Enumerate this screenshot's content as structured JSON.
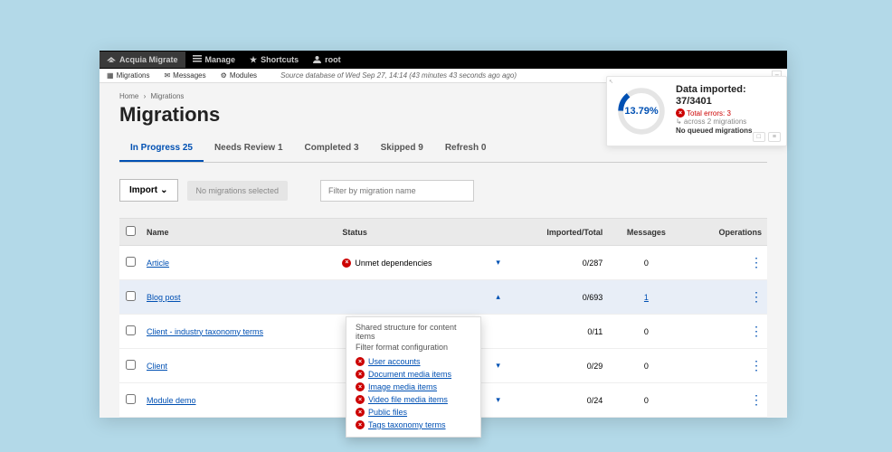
{
  "topbar": {
    "brand": "Acquia Migrate",
    "manage": "Manage",
    "shortcuts": "Shortcuts",
    "user": "root"
  },
  "secondbar": {
    "migrations": "Migrations",
    "messages": "Messages",
    "modules": "Modules",
    "source": "Source database of Wed Sep 27, 14:14 (43 minutes 43 seconds ago ago)"
  },
  "breadcrumb": {
    "home": "Home",
    "current": "Migrations"
  },
  "page_title": "Migrations",
  "tabs": [
    {
      "label": "In Progress",
      "count": "25",
      "active": true
    },
    {
      "label": "Needs Review",
      "count": "1",
      "active": false
    },
    {
      "label": "Completed",
      "count": "3",
      "active": false
    },
    {
      "label": "Skipped",
      "count": "9",
      "active": false
    },
    {
      "label": "Refresh",
      "count": "0",
      "active": false
    }
  ],
  "stats": {
    "tiny": "↖",
    "pct": "13.79%",
    "title": "Data imported:",
    "count": "37/3401",
    "errors": "Total errors: 3",
    "across": "↳ across 2 migrations",
    "noqueue": "No queued migrations"
  },
  "toolbar": {
    "import": "Import",
    "none_selected": "No migrations selected",
    "filter_placeholder": "Filter by migration name"
  },
  "columns": {
    "name": "Name",
    "status": "Status",
    "imported": "Imported/Total",
    "messages": "Messages",
    "operations": "Operations"
  },
  "rows": [
    {
      "name": "Article",
      "status": "Unmet dependencies",
      "imported": "0/287",
      "messages": "0",
      "chev": "▾",
      "selected": false
    },
    {
      "name": "Blog post",
      "status": "",
      "imported": "0/693",
      "messages": "1",
      "chev": "▴",
      "selected": true,
      "msglink": true
    },
    {
      "name": "Client - industry taxonomy terms",
      "status": "",
      "imported": "0/11",
      "messages": "0",
      "chev": "",
      "selected": false
    },
    {
      "name": "Client",
      "status": "",
      "imported": "0/29",
      "messages": "0",
      "chev": "▾",
      "selected": false
    },
    {
      "name": "Module demo",
      "status": "",
      "imported": "0/24",
      "messages": "0",
      "chev": "▾",
      "selected": false
    }
  ],
  "dropdown": {
    "head": "Shared structure for content items",
    "sub": "Filter format configuration",
    "items": [
      "User accounts",
      "Document media items",
      "Image media items",
      "Video file media items",
      "Public files",
      "Tags taxonomy terms"
    ]
  }
}
